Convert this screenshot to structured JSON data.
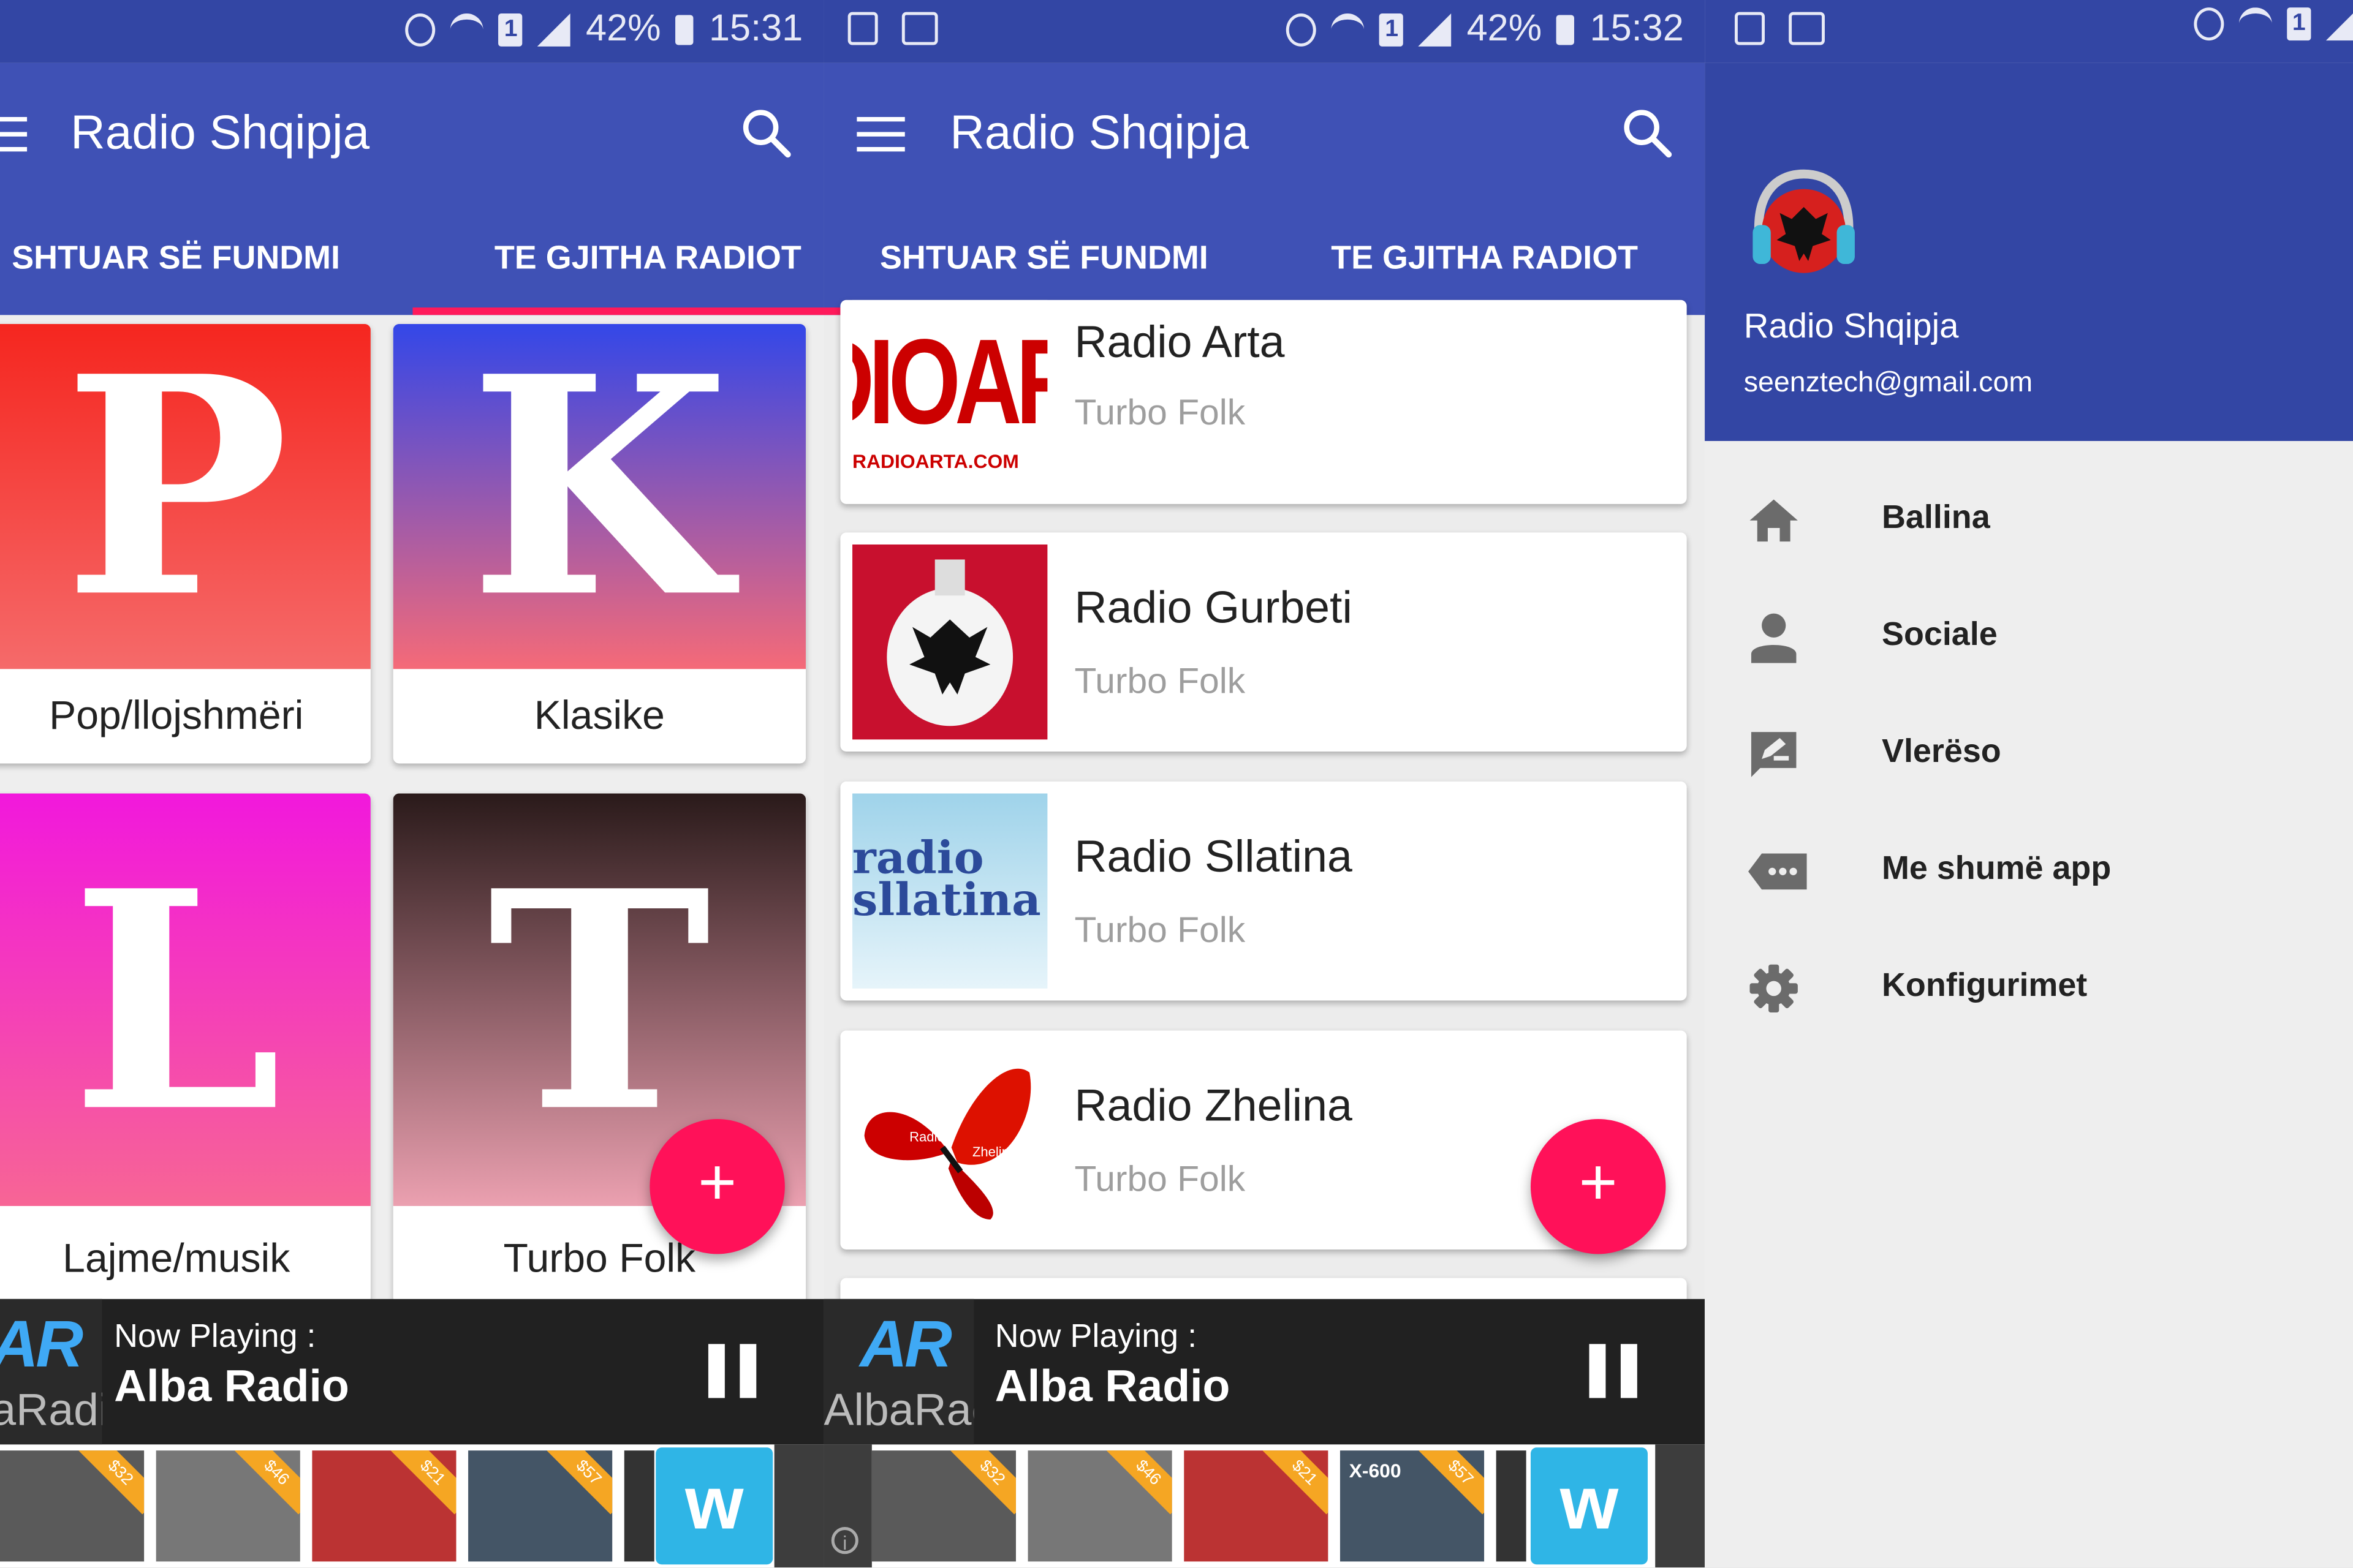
{
  "app": {
    "title": "Radio Shqipja"
  },
  "status": {
    "battery": "42%",
    "time_left": "15:31",
    "time_middle": "15:32",
    "sim": "1"
  },
  "tabs": {
    "recent": "SHTUAR SË FUNDMI",
    "all": "TE GJITHA RADIOT"
  },
  "categories": [
    {
      "letter": "P",
      "label": "Pop/llojshmëri"
    },
    {
      "letter": "K",
      "label": "Klasike"
    },
    {
      "letter": "L",
      "label": "Lajme/musik"
    },
    {
      "letter": "T",
      "label": "Turbo Folk"
    }
  ],
  "stations": [
    {
      "name": "Radio Arta",
      "genre": "Turbo Folk",
      "logo_text": "RADIOARTA.COM"
    },
    {
      "name": "Radio Gurbeti",
      "genre": "Turbo Folk"
    },
    {
      "name": "Radio Sllatina",
      "genre": "Turbo Folk",
      "logo_text": "radio sllatina"
    },
    {
      "name": "Radio Zhelina",
      "genre": "Turbo Folk",
      "logo_text": "Radio Zhelina"
    }
  ],
  "now_playing": {
    "label": "Now Playing :",
    "station": "Alba Radio",
    "logo": "AR AlbaRadio"
  },
  "ad": {
    "tags": [
      "$32",
      "$46",
      "$21",
      "$57"
    ],
    "brand_letter": "w",
    "tile_text": "X-600"
  },
  "fab": {
    "symbol": "+"
  },
  "drawer": {
    "name": "Radio Shqipja",
    "email": "seenztech@gmail.com",
    "items": [
      {
        "label": "Ballina",
        "icon": "home-icon"
      },
      {
        "label": "Sociale",
        "icon": "person-icon"
      },
      {
        "label": "Vlerëso",
        "icon": "rate-review-icon"
      },
      {
        "label": "Me shumë app",
        "icon": "more-apps-icon"
      },
      {
        "label": "Konfigurimet",
        "icon": "settings-icon"
      }
    ]
  },
  "colors": {
    "primary": "#3f51b5",
    "primary_dark": "#3346a4",
    "accent": "#ff1159"
  }
}
